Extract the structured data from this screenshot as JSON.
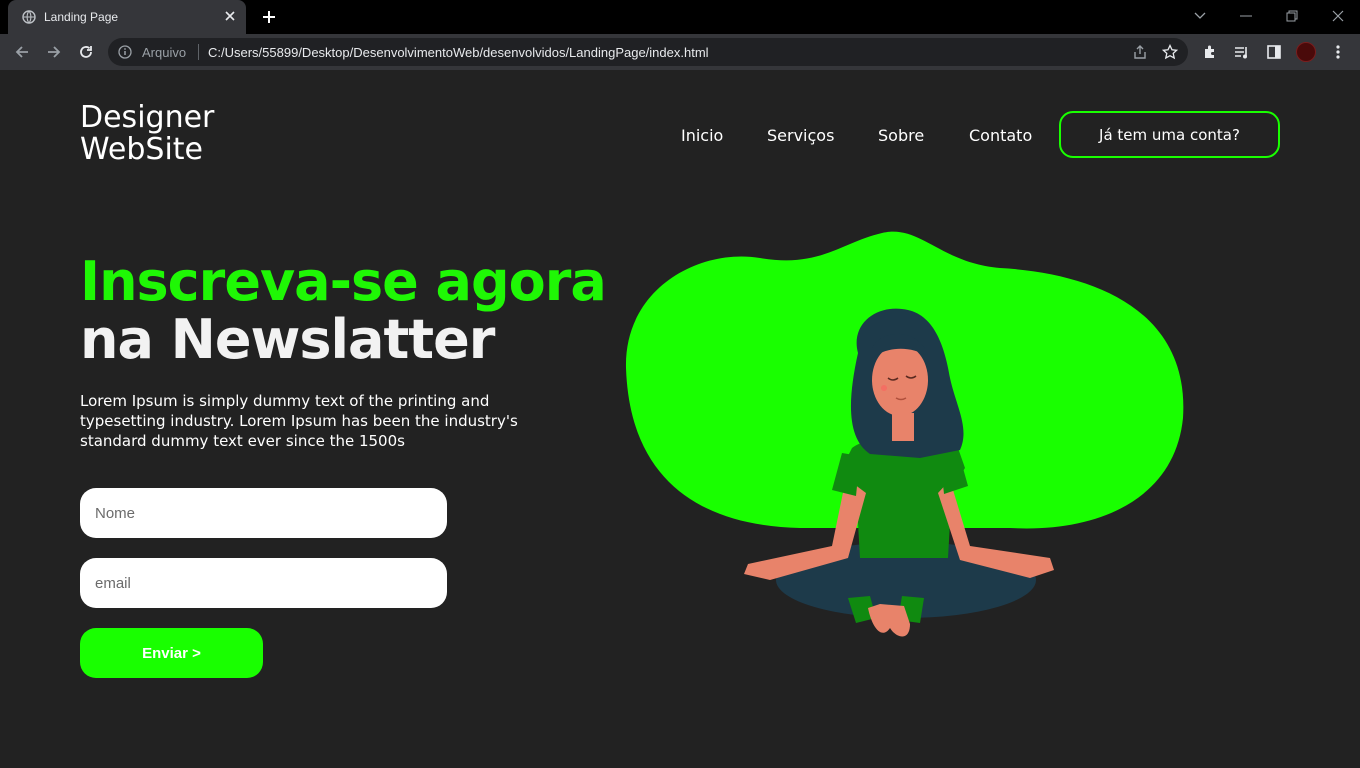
{
  "browser": {
    "tab_title": "Landing Page",
    "scheme_label": "Arquivo",
    "url": "C:/Users/55899/Desktop/DesenvolvimentoWeb/desenvolvidos/LandingPage/index.html"
  },
  "header": {
    "logo_line1": "Designer",
    "logo_line2": "WebSite",
    "nav": [
      "Inicio",
      "Serviços",
      "Sobre",
      "Contato"
    ],
    "account_button": "Já tem uma conta?"
  },
  "hero": {
    "headline_accent": "Inscreva-se agora",
    "headline_main": "na Newslatter",
    "lede": "Lorem Ipsum is simply dummy text of the printing and typesetting industry. Lorem Ipsum has been the industry's standard dummy text ever since the 1500s"
  },
  "form": {
    "name_placeholder": "Nome",
    "email_placeholder": "email",
    "submit_label": "Enviar >"
  },
  "colors": {
    "accent": "#19ff00",
    "background": "#222222",
    "text": "#ffffff"
  }
}
